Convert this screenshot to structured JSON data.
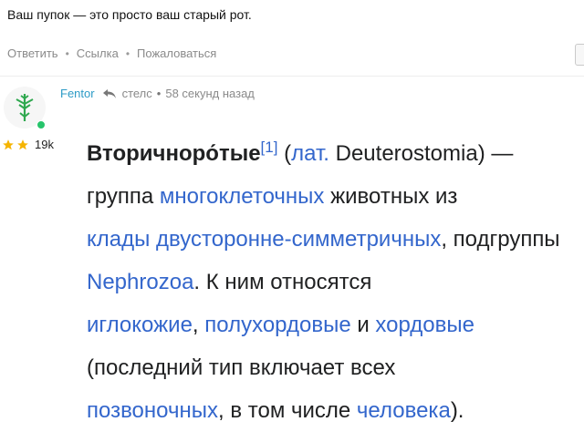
{
  "previous_comment": {
    "text": "Ваш пупок — это просто ваш старый рот.",
    "actions": [
      "Ответить",
      "Ссылка",
      "Пожаловаться"
    ]
  },
  "comment": {
    "author": "Fentor",
    "reply_to": "стелс",
    "separator": "•",
    "time": "58 секунд назад",
    "rating": "19k",
    "avatar_icon": "ingress-enlightened-icon",
    "online_color": "#27c46b",
    "content": {
      "term": "Вторичноро́тые",
      "ref": "[1]",
      "lat_open": " (",
      "lat_link": "лат.",
      "lat_term": " Deuterostomia) —",
      "t1": " группа ",
      "l1": "многоклеточных",
      "t2": " животных из ",
      "l2": "клады двусторонне-симметричных",
      "t3": ", подгруппы ",
      "l3": "Nephrozoa",
      "t4": ". К ним относятся ",
      "l4": "иглокожие",
      "t5": ", ",
      "l5": "полухордовые",
      "t6": " и ",
      "l6": "хордовые",
      "t7": " (последний тип включает всех ",
      "l7": "позвоночных",
      "t8": ", в том числе ",
      "l8": "человека",
      "t9": ")."
    }
  },
  "colors": {
    "link": "#3366cc",
    "username": "#2c9bc6",
    "meta": "#8a8a8a"
  }
}
